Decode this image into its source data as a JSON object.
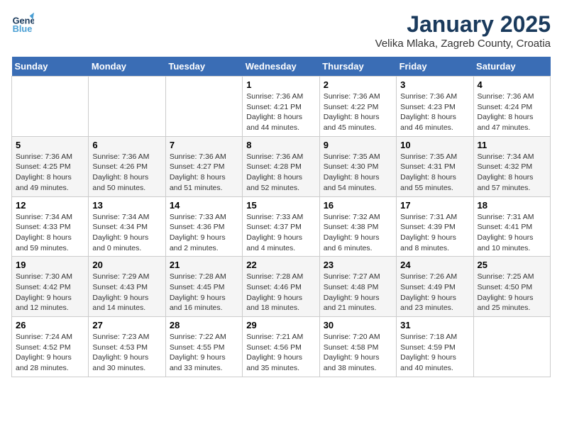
{
  "header": {
    "logo_line1": "General",
    "logo_line2": "Blue",
    "month": "January 2025",
    "location": "Velika Mlaka, Zagreb County, Croatia"
  },
  "weekdays": [
    "Sunday",
    "Monday",
    "Tuesday",
    "Wednesday",
    "Thursday",
    "Friday",
    "Saturday"
  ],
  "weeks": [
    [
      {
        "day": "",
        "info": ""
      },
      {
        "day": "",
        "info": ""
      },
      {
        "day": "",
        "info": ""
      },
      {
        "day": "1",
        "info": "Sunrise: 7:36 AM\nSunset: 4:21 PM\nDaylight: 8 hours\nand 44 minutes."
      },
      {
        "day": "2",
        "info": "Sunrise: 7:36 AM\nSunset: 4:22 PM\nDaylight: 8 hours\nand 45 minutes."
      },
      {
        "day": "3",
        "info": "Sunrise: 7:36 AM\nSunset: 4:23 PM\nDaylight: 8 hours\nand 46 minutes."
      },
      {
        "day": "4",
        "info": "Sunrise: 7:36 AM\nSunset: 4:24 PM\nDaylight: 8 hours\nand 47 minutes."
      }
    ],
    [
      {
        "day": "5",
        "info": "Sunrise: 7:36 AM\nSunset: 4:25 PM\nDaylight: 8 hours\nand 49 minutes."
      },
      {
        "day": "6",
        "info": "Sunrise: 7:36 AM\nSunset: 4:26 PM\nDaylight: 8 hours\nand 50 minutes."
      },
      {
        "day": "7",
        "info": "Sunrise: 7:36 AM\nSunset: 4:27 PM\nDaylight: 8 hours\nand 51 minutes."
      },
      {
        "day": "8",
        "info": "Sunrise: 7:36 AM\nSunset: 4:28 PM\nDaylight: 8 hours\nand 52 minutes."
      },
      {
        "day": "9",
        "info": "Sunrise: 7:35 AM\nSunset: 4:30 PM\nDaylight: 8 hours\nand 54 minutes."
      },
      {
        "day": "10",
        "info": "Sunrise: 7:35 AM\nSunset: 4:31 PM\nDaylight: 8 hours\nand 55 minutes."
      },
      {
        "day": "11",
        "info": "Sunrise: 7:34 AM\nSunset: 4:32 PM\nDaylight: 8 hours\nand 57 minutes."
      }
    ],
    [
      {
        "day": "12",
        "info": "Sunrise: 7:34 AM\nSunset: 4:33 PM\nDaylight: 8 hours\nand 59 minutes."
      },
      {
        "day": "13",
        "info": "Sunrise: 7:34 AM\nSunset: 4:34 PM\nDaylight: 9 hours\nand 0 minutes."
      },
      {
        "day": "14",
        "info": "Sunrise: 7:33 AM\nSunset: 4:36 PM\nDaylight: 9 hours\nand 2 minutes."
      },
      {
        "day": "15",
        "info": "Sunrise: 7:33 AM\nSunset: 4:37 PM\nDaylight: 9 hours\nand 4 minutes."
      },
      {
        "day": "16",
        "info": "Sunrise: 7:32 AM\nSunset: 4:38 PM\nDaylight: 9 hours\nand 6 minutes."
      },
      {
        "day": "17",
        "info": "Sunrise: 7:31 AM\nSunset: 4:39 PM\nDaylight: 9 hours\nand 8 minutes."
      },
      {
        "day": "18",
        "info": "Sunrise: 7:31 AM\nSunset: 4:41 PM\nDaylight: 9 hours\nand 10 minutes."
      }
    ],
    [
      {
        "day": "19",
        "info": "Sunrise: 7:30 AM\nSunset: 4:42 PM\nDaylight: 9 hours\nand 12 minutes."
      },
      {
        "day": "20",
        "info": "Sunrise: 7:29 AM\nSunset: 4:43 PM\nDaylight: 9 hours\nand 14 minutes."
      },
      {
        "day": "21",
        "info": "Sunrise: 7:28 AM\nSunset: 4:45 PM\nDaylight: 9 hours\nand 16 minutes."
      },
      {
        "day": "22",
        "info": "Sunrise: 7:28 AM\nSunset: 4:46 PM\nDaylight: 9 hours\nand 18 minutes."
      },
      {
        "day": "23",
        "info": "Sunrise: 7:27 AM\nSunset: 4:48 PM\nDaylight: 9 hours\nand 21 minutes."
      },
      {
        "day": "24",
        "info": "Sunrise: 7:26 AM\nSunset: 4:49 PM\nDaylight: 9 hours\nand 23 minutes."
      },
      {
        "day": "25",
        "info": "Sunrise: 7:25 AM\nSunset: 4:50 PM\nDaylight: 9 hours\nand 25 minutes."
      }
    ],
    [
      {
        "day": "26",
        "info": "Sunrise: 7:24 AM\nSunset: 4:52 PM\nDaylight: 9 hours\nand 28 minutes."
      },
      {
        "day": "27",
        "info": "Sunrise: 7:23 AM\nSunset: 4:53 PM\nDaylight: 9 hours\nand 30 minutes."
      },
      {
        "day": "28",
        "info": "Sunrise: 7:22 AM\nSunset: 4:55 PM\nDaylight: 9 hours\nand 33 minutes."
      },
      {
        "day": "29",
        "info": "Sunrise: 7:21 AM\nSunset: 4:56 PM\nDaylight: 9 hours\nand 35 minutes."
      },
      {
        "day": "30",
        "info": "Sunrise: 7:20 AM\nSunset: 4:58 PM\nDaylight: 9 hours\nand 38 minutes."
      },
      {
        "day": "31",
        "info": "Sunrise: 7:18 AM\nSunset: 4:59 PM\nDaylight: 9 hours\nand 40 minutes."
      },
      {
        "day": "",
        "info": ""
      }
    ]
  ]
}
